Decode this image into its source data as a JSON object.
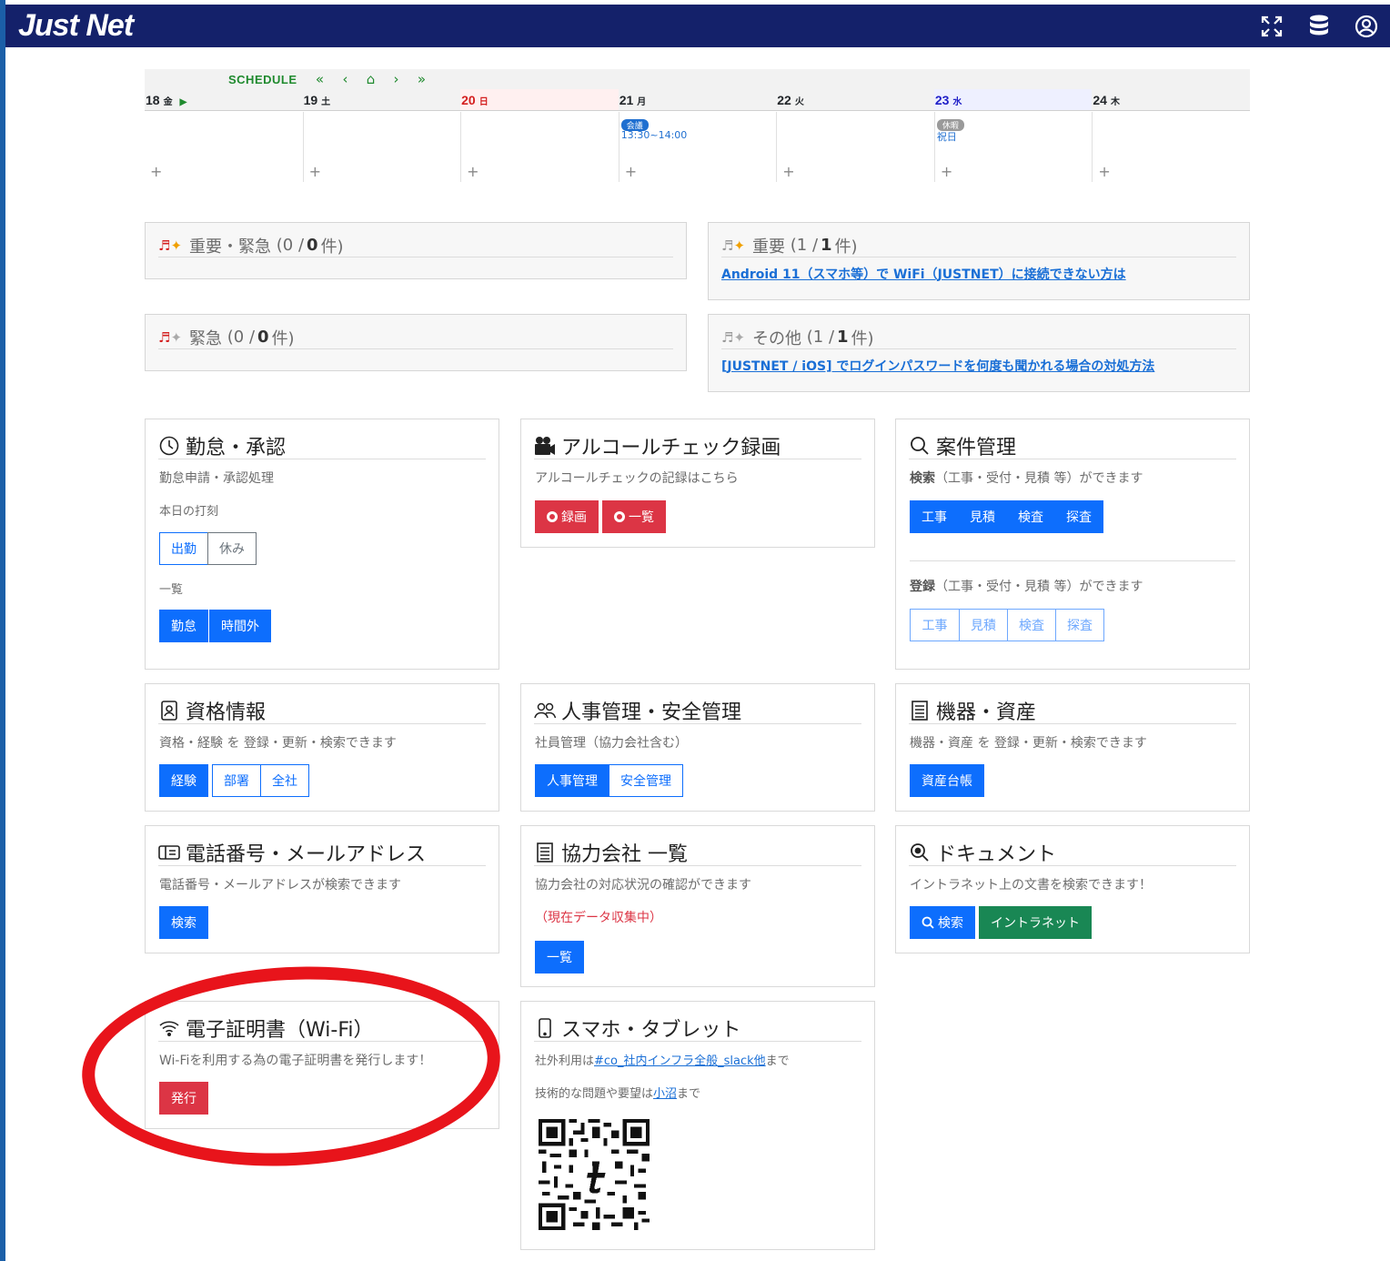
{
  "navbar": {
    "brand": "Just Net",
    "icons": [
      "fullscreen-icon",
      "database-icon",
      "user-circle-icon"
    ],
    "bg_color": "#14216a"
  },
  "schedule": {
    "title": "SCHEDULE",
    "nav": [
      "«",
      "‹",
      "⌂",
      "›",
      "»"
    ],
    "days": [
      {
        "date": "18",
        "dow": "金",
        "marker": "▶"
      },
      {
        "date": "19",
        "dow": "土"
      },
      {
        "date": "20",
        "dow": "日"
      },
      {
        "date": "21",
        "dow": "月",
        "badge": "会議",
        "event": "13:30~14:00"
      },
      {
        "date": "22",
        "dow": "火"
      },
      {
        "date": "23",
        "dow": "水",
        "badge": "休暇",
        "event": "祝日"
      },
      {
        "date": "24",
        "dow": "木"
      }
    ],
    "add": "+"
  },
  "notices": {
    "important_urgent": {
      "label": "重要・緊急",
      "count": "(0 / ",
      "count_bold": "0",
      "unit": " 件)"
    },
    "important": {
      "label": "重要",
      "count": "(1 / ",
      "count_bold": "1",
      "unit": " 件)",
      "link": "Android 11（スマホ等）で WiFi（JUSTNET）に接続できない方は"
    },
    "urgent": {
      "label": "緊急",
      "count": "(0 / ",
      "count_bold": "0",
      "unit": " 件)"
    },
    "other": {
      "label": "その他",
      "count": "(1 / ",
      "count_bold": "1",
      "unit": " 件)",
      "link": "[JUSTNET / iOS] でログインパスワードを何度も聞かれる場合の対処方法"
    }
  },
  "cards": {
    "attendance": {
      "title": "勤怠・承認",
      "desc": "勤怠申請・承認処理",
      "today_label": "本日の打刻",
      "btn_in": "出勤",
      "btn_rest": "休み",
      "list_label": "一覧",
      "btn_kintai": "勤怠",
      "btn_overtime": "時間外"
    },
    "alcohol": {
      "title": "アルコールチェック録画",
      "desc": "アルコールチェックの記録はこちら",
      "btn_record": "録画",
      "btn_list": "一覧"
    },
    "project": {
      "title": "案件管理",
      "search_desc_bold": "検索",
      "search_desc": "（工事・受付・見積 等）ができます",
      "search_btns": [
        "工事",
        "見積",
        "検査",
        "探査"
      ],
      "reg_desc_bold": "登録",
      "reg_desc": "（工事・受付・見積 等）ができます",
      "reg_btns": [
        "工事",
        "見積",
        "検査",
        "探査"
      ]
    },
    "qualification": {
      "title": "資格情報",
      "desc": "資格・経験 を 登録・更新・検索できます",
      "btns": [
        "経験",
        "部署",
        "全社"
      ]
    },
    "hr": {
      "title": "人事管理・安全管理",
      "desc": "社員管理（協力会社含む）",
      "btns": [
        "人事管理",
        "安全管理"
      ]
    },
    "equipment": {
      "title": "機器・資産",
      "desc": "機器・資産 を 登録・更新・検索できます",
      "btn": "資産台帳"
    },
    "phone": {
      "title": "電話番号・メールアドレス",
      "desc": "電話番号・メールアドレスが検索できます",
      "btn": "検索"
    },
    "partners": {
      "title": "協力会社 一覧",
      "desc": "協力会社の対応状況の確認ができます",
      "note": "（現在データ収集中）",
      "btn": "一覧"
    },
    "documents": {
      "title": "ドキュメント",
      "desc": "イントラネット上の文書を検索できます！",
      "btn_search": "検索",
      "btn_intranet": "イントラネット"
    },
    "cert": {
      "title": "電子証明書（Wi-Fi）",
      "desc": "Wi-Fiを利用する為の電子証明書を発行します！",
      "btn": "発行"
    },
    "mobile": {
      "title": "スマホ・タブレット",
      "line1_pre": "社外利用は",
      "line1_link": "#co_社内インフラ全般_slack他",
      "line1_post": "まで",
      "line2_pre": "技術的な問題や要望は",
      "line2_link": "小沼",
      "line2_post": "まで"
    }
  },
  "colors": {
    "primary": "#0d6efd",
    "danger": "#dc3545",
    "success": "#198754",
    "annotation": "#e8141b"
  }
}
